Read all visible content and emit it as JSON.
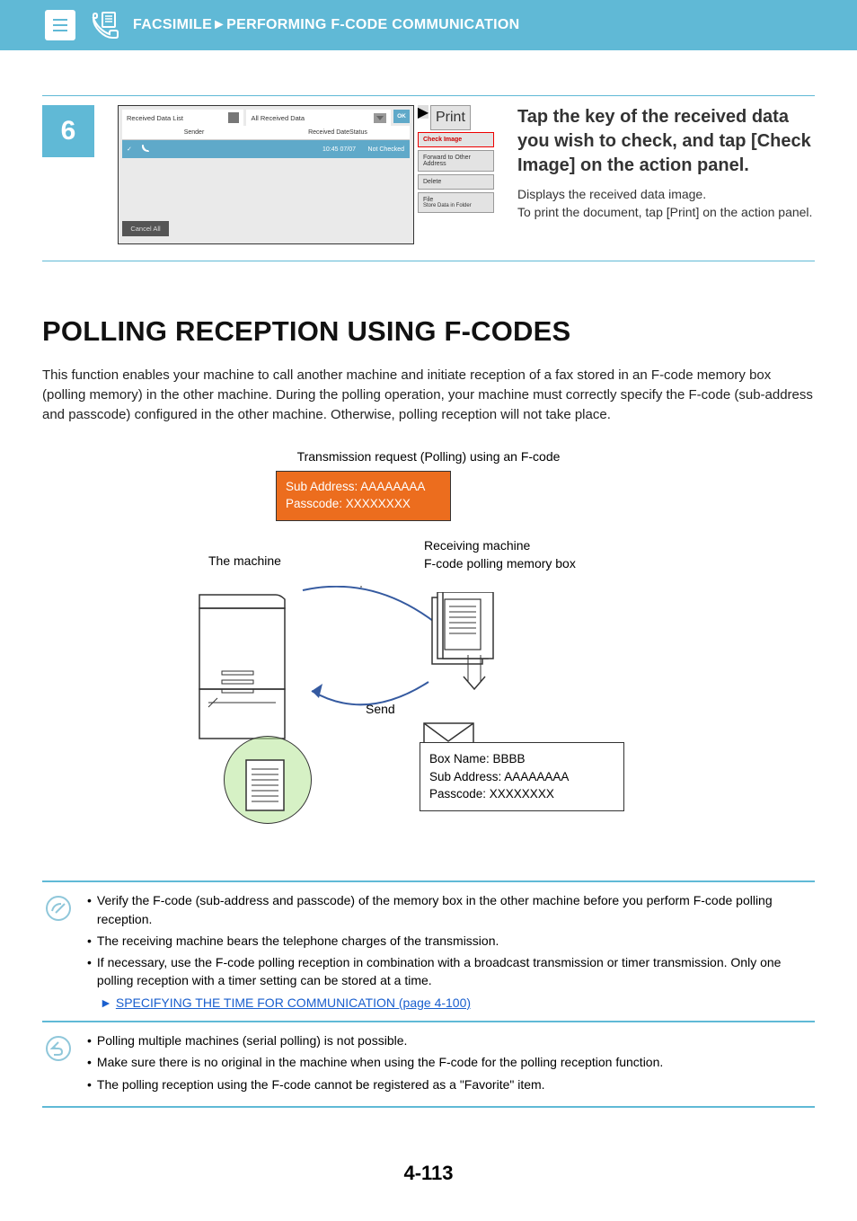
{
  "header": {
    "breadcrumb": "FACSIMILE►PERFORMING F-CODE COMMUNICATION"
  },
  "step": {
    "number": "6",
    "heading": "Tap the key of the received data you wish to check, and tap [Check Image] on the action panel.",
    "desc1": "Displays the received data image.",
    "desc2": "To print the document, tap [Print] on the action panel."
  },
  "screenshot": {
    "tab1": "Received Data List",
    "tab2": "All Received Data",
    "ok": "OK",
    "col_sender": "Sender",
    "col_datestatus": "Received DateStatus",
    "row_time": "10:45 07/07",
    "row_status": "Not Checked",
    "cancel": "Cancel All",
    "actions": {
      "print": "Print",
      "check_image": "Check Image",
      "forward": "Forward to Other Address",
      "delete": "Delete",
      "file": "File",
      "file_sub": "Store Data in Folder"
    }
  },
  "section": {
    "title": "POLLING RECEPTION USING F-CODES",
    "body": "This function enables your machine to call another machine and initiate reception of a fax stored in an F-code memory box (polling memory) in the other machine. During the polling operation, your machine must correctly specify the F-code (sub-address and passcode) configured in the other machine. Otherwise, polling reception will not take place."
  },
  "diagram": {
    "caption": "Transmission request (Polling) using an F-code",
    "orange_line1": "Sub Address: AAAAAAAA",
    "orange_line2": "Passcode: XXXXXXXX",
    "label_machine": "The machine",
    "label_receiving": "Receiving machine\nF-code polling memory box",
    "label_send": "Send",
    "info_line1": "Box Name: BBBB",
    "info_line2": "Sub Address: AAAAAAAA",
    "info_line3": "Passcode: XXXXXXXX"
  },
  "notes1": [
    "Verify the F-code (sub-address and passcode) of the memory box in the other machine before you perform F-code polling reception.",
    "The receiving machine bears the telephone charges of the transmission.",
    "If necessary, use the F-code polling reception in combination with a broadcast transmission or timer transmission. Only one polling reception with a timer setting can be stored at a time."
  ],
  "notes1_link": "SPECIFYING THE TIME FOR COMMUNICATION (page 4-100)",
  "notes2": [
    "Polling multiple machines (serial polling) is not possible.",
    "Make sure there is no original in the machine when using the F-code for the polling reception function.",
    "The polling reception using the F-code cannot be registered as a \"Favorite\" item."
  ],
  "page_number": "4-113"
}
